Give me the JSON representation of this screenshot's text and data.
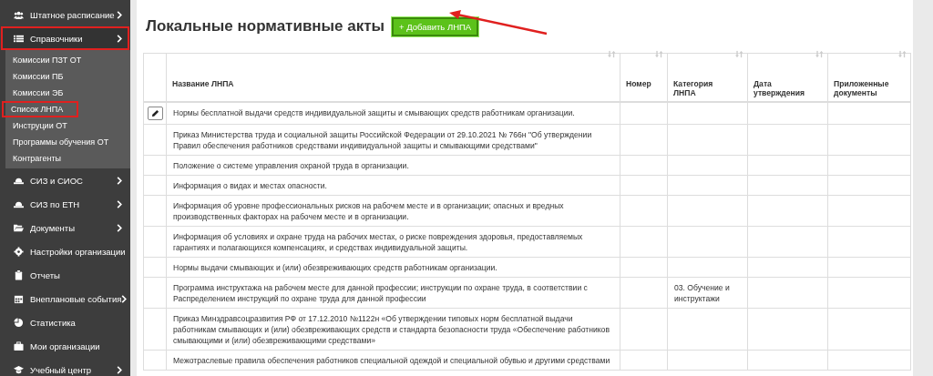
{
  "sidebar": {
    "items": [
      {
        "label": "Штатное расписание",
        "has_arrow": true,
        "annotated": false
      },
      {
        "label": "Справочники",
        "has_arrow": true,
        "annotated": true,
        "children": [
          {
            "label": "Комиссии ПЗТ ОТ",
            "annotated": false
          },
          {
            "label": "Комиссии ПБ",
            "annotated": false
          },
          {
            "label": "Комиссии ЭБ",
            "annotated": false
          },
          {
            "label": "Список ЛНПА",
            "annotated": true
          },
          {
            "label": "Инструции ОТ",
            "annotated": false
          },
          {
            "label": "Программы обучения ОТ",
            "annotated": false
          },
          {
            "label": "Контрагенты",
            "annotated": false
          }
        ]
      },
      {
        "label": "СИЗ и СИОС",
        "has_arrow": true,
        "annotated": false
      },
      {
        "label": "СИЗ по ЕТН",
        "has_arrow": true,
        "annotated": false
      },
      {
        "label": "Документы",
        "has_arrow": true,
        "annotated": false
      },
      {
        "label": "Настройки организации",
        "has_arrow": false,
        "annotated": false
      },
      {
        "label": "Отчеты",
        "has_arrow": false,
        "annotated": false
      },
      {
        "label": "Внеплановые события",
        "has_arrow": true,
        "annotated": false
      },
      {
        "label": "Статистика",
        "has_arrow": false,
        "annotated": false
      },
      {
        "label": "Мои организации",
        "has_arrow": false,
        "annotated": false
      },
      {
        "label": "Учебный центр",
        "has_arrow": true,
        "annotated": false
      }
    ]
  },
  "page": {
    "title": "Локальные нормативные акты",
    "add_button": "+ Добавить ЛНПА",
    "add_button_annotated": true
  },
  "table": {
    "columns": [
      {
        "sortable": false
      },
      {
        "label": "Название ЛНПА",
        "sortable": true
      },
      {
        "label": "Номер",
        "sortable": true
      },
      {
        "label": "Категория ЛНПА",
        "sortable": true
      },
      {
        "label": "Дата утверждения",
        "sortable": true
      },
      {
        "label": "Приложенные документы",
        "sortable": true
      }
    ],
    "rows": [
      {
        "edit": true,
        "name": "Нормы бесплатной выдачи средств индивидуальной защиты и смывающих средств работникам организации."
      },
      {
        "edit": false,
        "name": "Приказ Министерства труда и социальной защиты Российской Федерации от 29.10.2021 № 766н \"Об утверждении Правил обеспечения работников средствами индивидуальной защиты и смывающими средствами\""
      },
      {
        "edit": false,
        "name": "Положение о системе управления охраной труда в организации."
      },
      {
        "edit": false,
        "name": "Информация о видах и местах опасности."
      },
      {
        "edit": false,
        "name": "Информация об уровне профессиональных рисков на рабочем месте и в организации; опасных и вредных производственных факторах на рабочем месте и в организации."
      },
      {
        "edit": false,
        "name": "Информация об условиях и охране труда на рабочих местах, о риске повреждения здоровья, предоставляемых гарантиях и полагающихся компенсациях, и средствах индивидуальной защиты."
      },
      {
        "edit": false,
        "name": "Нормы выдачи смывающих и (или) обезвреживающих средств работникам организации."
      },
      {
        "edit": false,
        "name": "Программа инструктажа на рабочем месте для данной профессии; инструкции по охране труда, в соответствии с Распределением инструкций по охране труда для данной профессии",
        "category": "03. Обучение и инструктажи"
      },
      {
        "edit": false,
        "name": "Приказ Минздравсоцразвития РФ от 17.12.2010 №1122н «Об утверждении типовых норм бесплатной выдачи работникам смывающих и (или) обезвреживающих средств и стандарта безопасности труда «Обеспечение работников смывающими и (или) обезвреживающими средствами»"
      },
      {
        "edit": false,
        "name": "Межотраслевые правила обеспечения работников специальной одеждой и специальной обувью и другими средствами"
      }
    ]
  }
}
